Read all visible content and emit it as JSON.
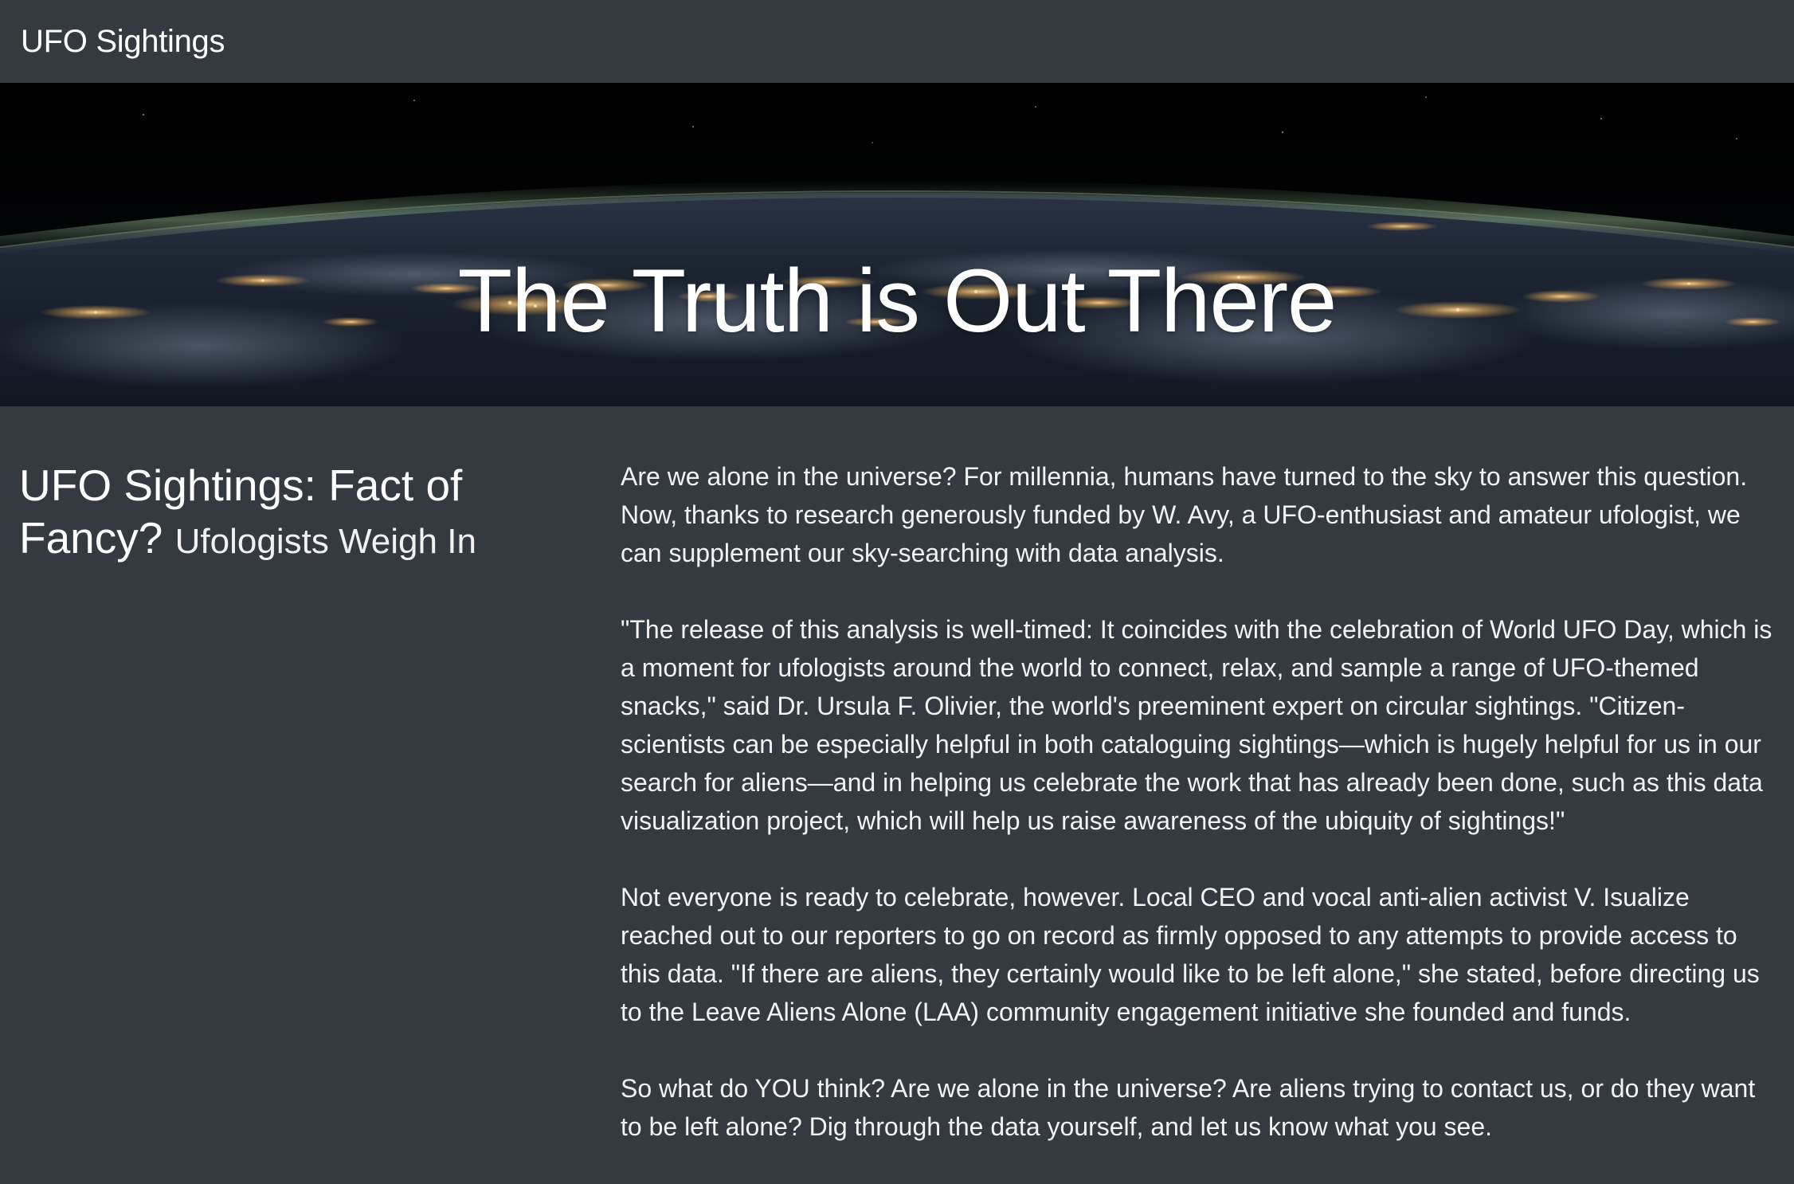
{
  "navbar": {
    "brand": "UFO Sightings"
  },
  "hero": {
    "title": "The Truth is Out There",
    "background": "earth-at-night-from-space"
  },
  "article": {
    "heading": "UFO Sightings: Fact of Fancy?",
    "subheading": "Ufologists Weigh In",
    "paragraphs": [
      "Are we alone in the universe? For millennia, humans have turned to the sky to answer this question. Now, thanks to research generously funded by W. Avy, a UFO-enthusiast and amateur ufologist, we can supplement our sky-searching with data analysis.",
      "\"The release of this analysis is well-timed: It coincides with the celebration of World UFO Day, which is a moment for ufologists around the world to connect, relax, and sample a range of UFO-themed snacks,\" said Dr. Ursula F. Olivier, the world's preeminent expert on circular sightings. \"Citizen-scientists can be especially helpful in both cataloguing sightings—which is hugely helpful for us in our search for aliens—and in helping us celebrate the work that has already been done, such as this data visualization project, which will help us raise awareness of the ubiquity of sightings!\"",
      "Not everyone is ready to celebrate, however. Local CEO and vocal anti-alien activist V. Isualize reached out to our reporters to go on record as firmly opposed to any attempts to provide access to this data. \"If there are aliens, they certainly would like to be left alone,\" she stated, before directing us to the Leave Aliens Alone (LAA) community engagement initiative she founded and funds.",
      "So what do YOU think? Are we alone in the universe? Are aliens trying to contact us, or do they want to be left alone? Dig through the data yourself, and let us know what you see."
    ]
  },
  "colors": {
    "page_background": "#343a40",
    "text": "#ffffff"
  }
}
